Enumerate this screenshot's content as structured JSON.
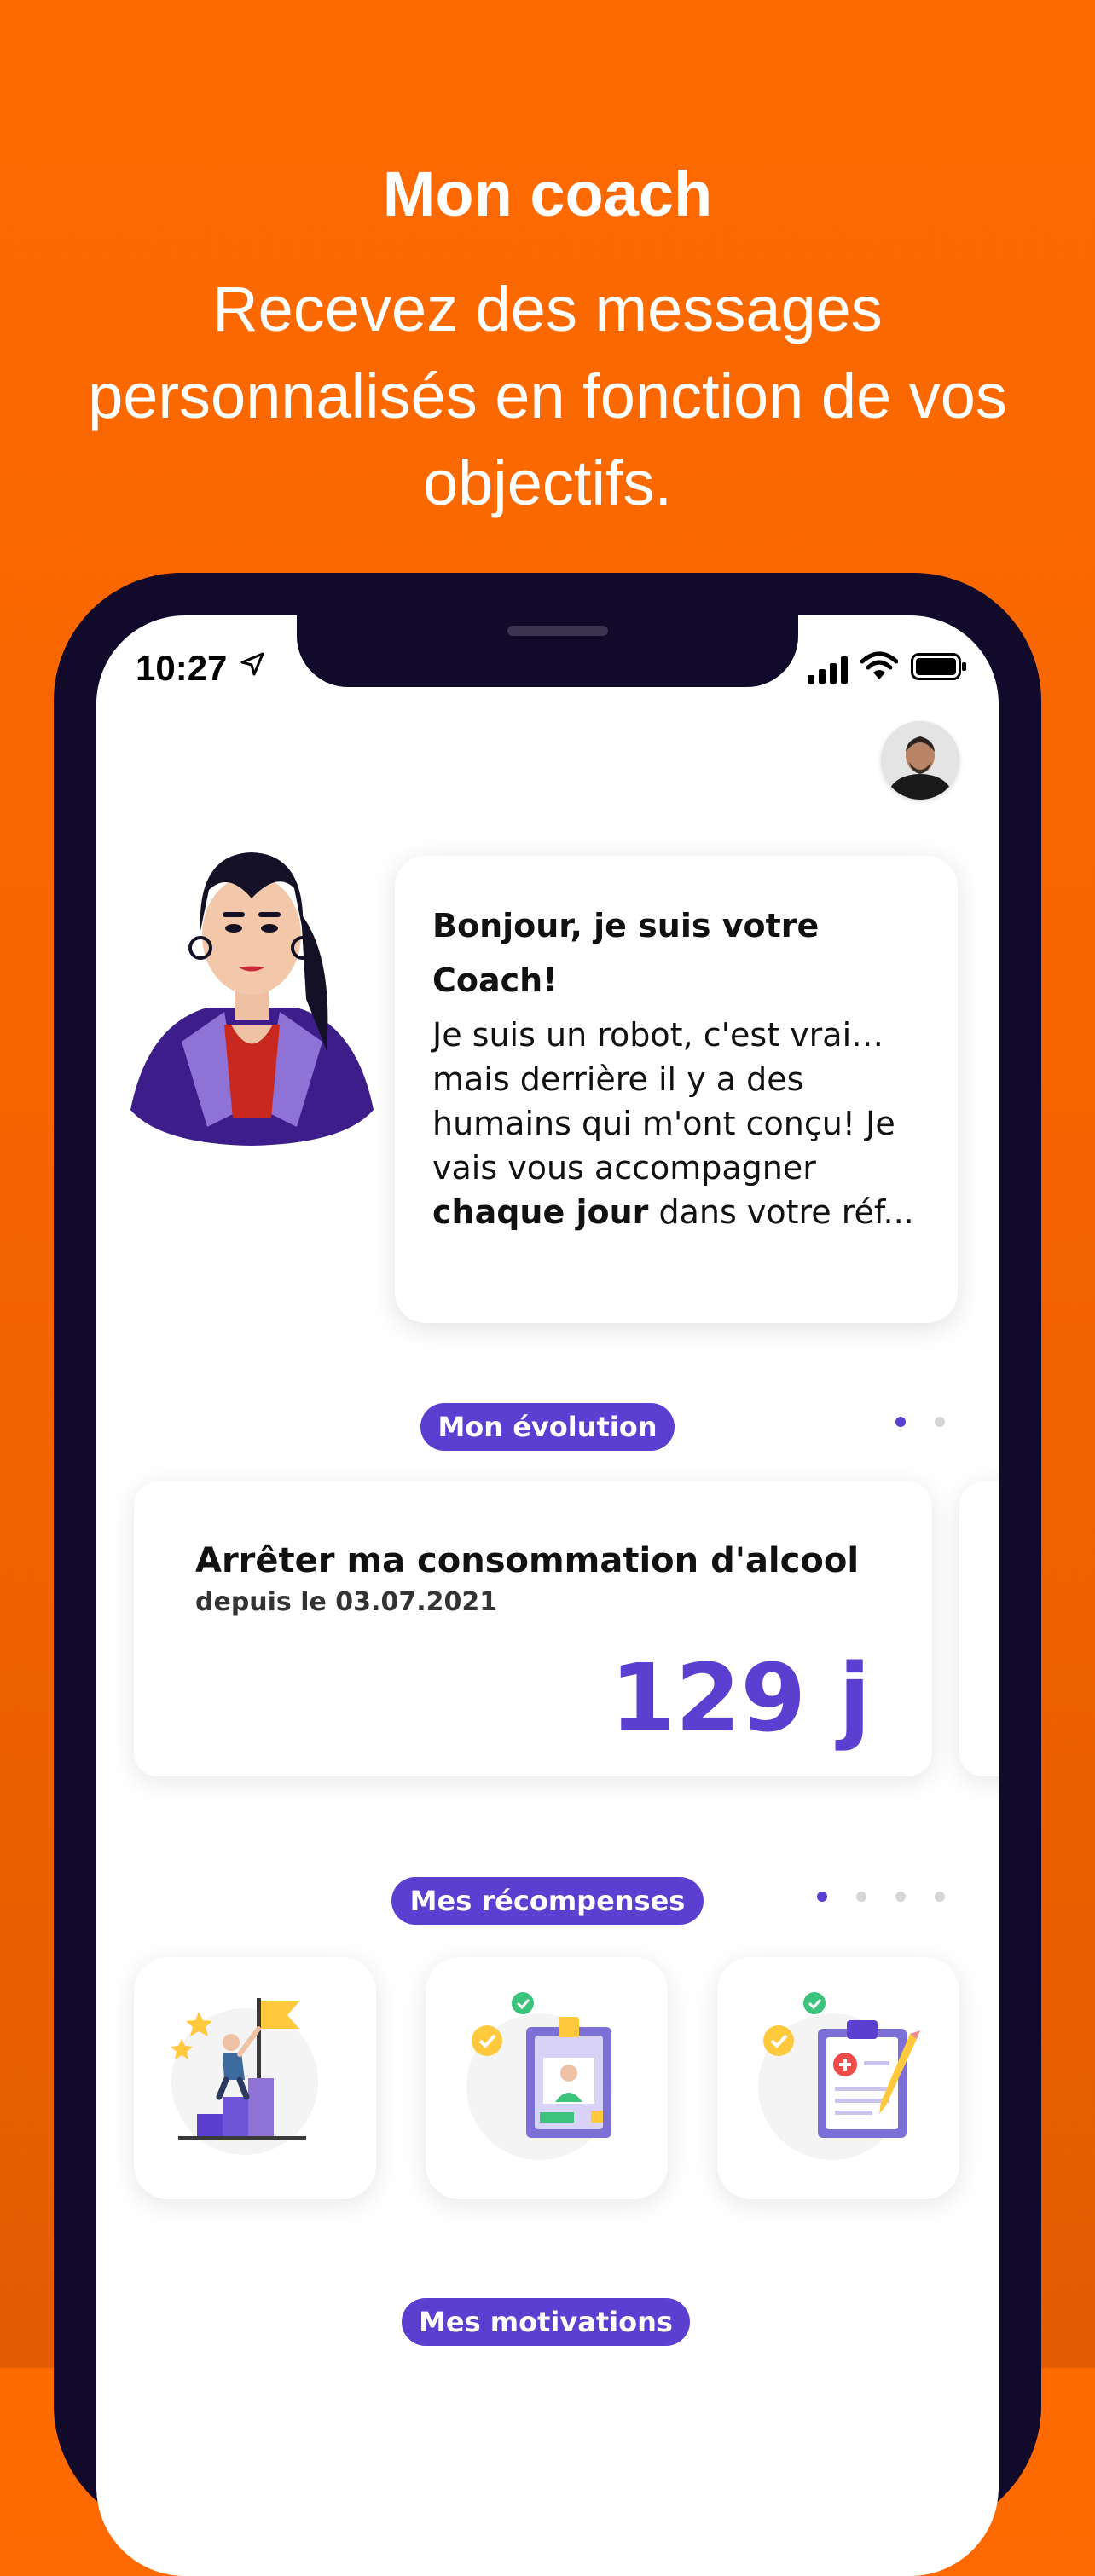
{
  "hero": {
    "title": "Mon coach",
    "subtitle": "Recevez des messages personnalisés en fonction de vos objectifs."
  },
  "status_bar": {
    "time": "10:27",
    "icons": [
      "location-arrow-icon",
      "signal-icon",
      "wifi-icon",
      "battery-icon"
    ]
  },
  "coach": {
    "greeting": "Bonjour, je suis votre Coach!",
    "message_part1": "Je suis un robot, c'est vrai… mais derrière il y a des humains qui m'ont conçu! Je vais vous accompagner ",
    "message_bold": "chaque jour",
    "message_part2": " dans votre réf..."
  },
  "evolution": {
    "label": "Mon évolution",
    "page_count": 2,
    "active_page": 1,
    "card": {
      "title": "Arrêter ma consommation d'alcool",
      "since": "depuis le 03.07.2021",
      "days": "129 j"
    }
  },
  "rewards": {
    "label": "Mes récompenses",
    "page_count": 4,
    "active_page": 1,
    "items": [
      "flag-goal-icon",
      "id-badge-check-icon",
      "clipboard-check-icon"
    ]
  },
  "motivations": {
    "label": "Mes motivations"
  },
  "colors": {
    "background": "#ff6a00",
    "accent": "#5b3fd0",
    "phone_frame": "#110a2b"
  }
}
